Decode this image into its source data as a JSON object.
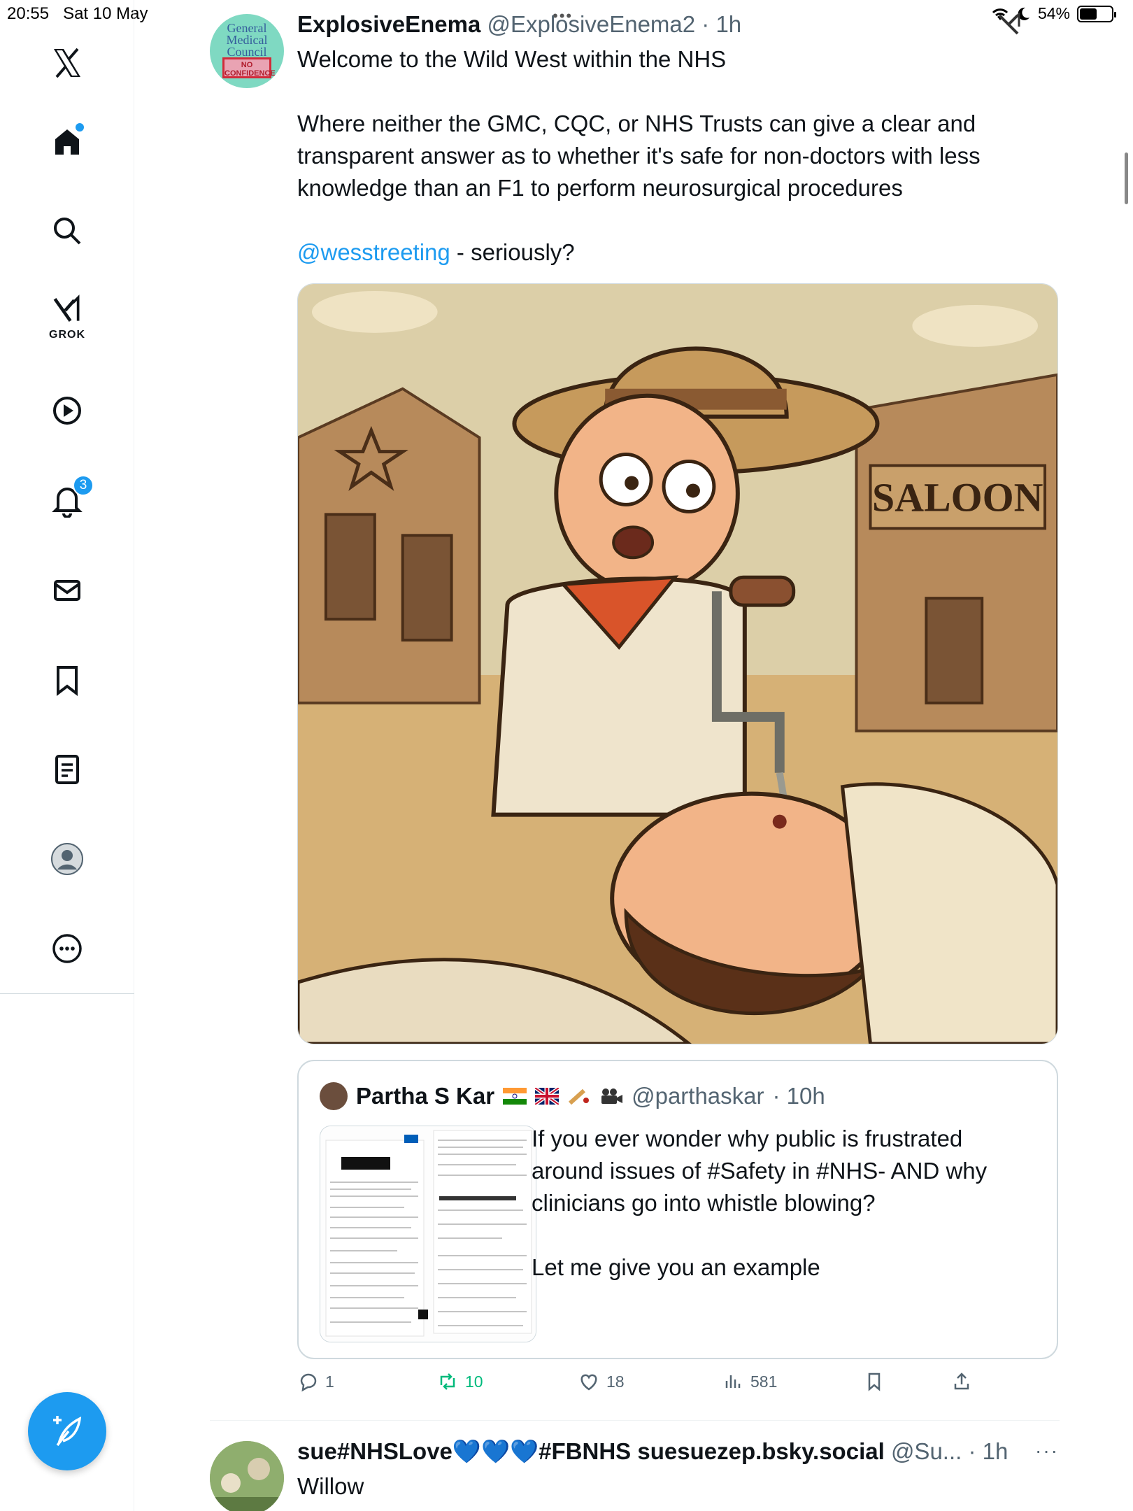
{
  "status_bar": {
    "time": "20:55",
    "date": "Sat 10 May",
    "battery": "54%",
    "battery_level": 0.54
  },
  "sidebar": {
    "items": [
      {
        "icon": "x-logo-icon"
      },
      {
        "icon": "home-icon"
      },
      {
        "icon": "search-icon"
      },
      {
        "icon": "grok-icon",
        "label": "GROK"
      },
      {
        "icon": "video-icon"
      },
      {
        "icon": "bell-icon",
        "badge": "3"
      },
      {
        "icon": "mail-icon"
      },
      {
        "icon": "bookmark-icon"
      },
      {
        "icon": "lists-icon"
      },
      {
        "icon": "profile-icon"
      },
      {
        "icon": "more-icon"
      }
    ],
    "compose_icon": "compose-feather-icon"
  },
  "tweet": {
    "avatar_text": "General Medical Council",
    "avatar_stamp": "NO CONFIDENCE",
    "author_name": "ExplosiveEnema",
    "handle": "@ExplosiveEnema2",
    "time": "· 1h",
    "text_line1": "Welcome to the Wild West within the NHS",
    "text_body": "Where neither the GMC, CQC, or NHS Trusts can give a clear and transparent answer as to whether it's safe for non-doctors with less knowledge than an F1 to perform neurosurgical procedures",
    "mention": "@wesstreeting",
    "mention_suffix": " - seriously?",
    "image_sign": "SALOON",
    "quote": {
      "author_name": "Partha S Kar",
      "handle": "@parthaskar",
      "time": "· 10h",
      "text": "If you ever wonder why public is frustrated around issues of #Safety in #NHS- AND why clinicians go into whistle blowing?\n\nLet me give you an example"
    },
    "actions": {
      "replies": "1",
      "retweets": "10",
      "likes": "18",
      "views": "581"
    }
  },
  "next_tweet": {
    "author_name": "sue#NHSLove💙💙💙#FBNHS suesuezep.bsky.social",
    "handle": "@Su...",
    "time": "· 1h",
    "text": "Willow"
  },
  "colors": {
    "accent": "#1d9bf0",
    "muted": "#536471",
    "retweet_green": "#00ba7c"
  }
}
